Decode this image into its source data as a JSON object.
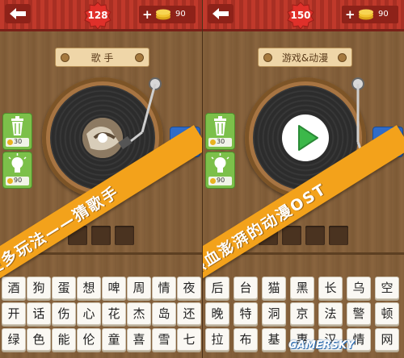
{
  "left": {
    "level": "128",
    "coins": "90",
    "coins_plus": "+",
    "category": "歌 手",
    "hint_costs": [
      "30",
      "90"
    ],
    "answer_slots": 3,
    "ribbon": "更多玩法——猜歌手",
    "keyboard": [
      [
        "酒",
        "狗",
        "蛋",
        "想",
        "啤",
        "周",
        "情",
        "夜"
      ],
      [
        "开",
        "话",
        "伤",
        "心",
        "花",
        "杰",
        "岛",
        "还"
      ],
      [
        "绿",
        "色",
        "能",
        "伦",
        "童",
        "喜",
        "雪",
        "七"
      ]
    ]
  },
  "right": {
    "level": "150",
    "coins": "90",
    "coins_plus": "+",
    "category": "游戏&动漫",
    "hint_costs": [
      "30",
      "90"
    ],
    "answer_slots": 4,
    "ribbon": "热血澎湃的动漫OST",
    "keyboard": [
      [
        "后",
        "台",
        "猫",
        "黑",
        "长",
        "乌",
        "空"
      ],
      [
        "晚",
        "特",
        "洞",
        "京",
        "法",
        "警",
        "顿"
      ],
      [
        "拉",
        "布",
        "基",
        "惠",
        "汉",
        "情",
        "网"
      ]
    ]
  },
  "watermark": "GAMERSKY",
  "colors": {
    "topbar": "#c0392b",
    "ribbon": "#f3a21b",
    "hint_green": "#7cc04a",
    "share_blue": "#2f6cc9",
    "wood": "#84603b"
  },
  "icons": [
    "back-arrow-icon",
    "level-badge-icon",
    "coin-stack-icon",
    "trash-icon",
    "lightbulb-icon",
    "share-icon",
    "play-icon",
    "vinyl-record-icon",
    "tonearm-icon"
  ]
}
